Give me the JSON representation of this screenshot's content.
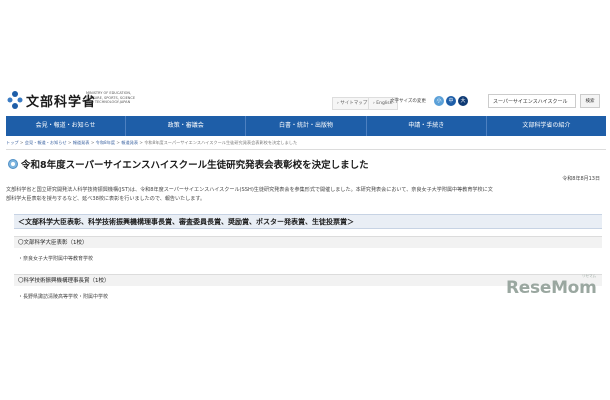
{
  "header": {
    "logo_text": "文部科学省",
    "logo_sub": "MINISTRY OF EDUCATION, CULTURE, SPORTS, SCIENCE AND TECHNOLOGY-JAPAN",
    "sitemap": "サイトマップ",
    "english": "English",
    "font_size_label": "文字サイズの変更",
    "font_small": "小",
    "font_medium": "中",
    "font_large": "大",
    "search_value": "スーパーサイエンスハイスクール",
    "search_button": "検索"
  },
  "nav": [
    "会見・報道・お知らせ",
    "政策・審議会",
    "白書・統計・出版物",
    "申請・手続き",
    "文部科学省の紹介"
  ],
  "breadcrumb": {
    "items": [
      "トップ",
      "会見・報道・お知らせ",
      "報道発表",
      "令和8年度",
      "報道発表"
    ],
    "current": "令和8年度スーパーサイエンスハイスクール生徒研究発表会表彰校を決定しました"
  },
  "article": {
    "title": "令和8年度スーパーサイエンスハイスクール生徒研究発表会表彰校を決定しました",
    "date": "令和8年8月13日",
    "body_line1": "文部科学省と国立研究開発法人科学技術振興機構(JST)は、令和8年度スーパーサイエンスハイスクール(SSH)生徒研究発表会を参集形式で開催しました。本研究発表会において、奈良女子大学附属中等教育学校に文",
    "body_line2": "部科学大臣表彰を授与するなど、延べ38校に表彰を行いましたので、報告いたします。",
    "section_heading": "＜文部科学大臣表彰、科学技術振興機構理事長賞、審査委員長賞、奨励賞、ポスター発表賞、生徒投票賞＞",
    "awards": [
      {
        "name": "〇文部科学大臣表彰（1校）",
        "school": "・奈良女子大学附属中等教育学校"
      },
      {
        "name": "〇科学技術振興機構理事長賞（1校）",
        "school": "・長野県諏訪清陵高等学校・附属中学校"
      }
    ]
  },
  "watermark": {
    "text": "ReseMom",
    "small": "リセマム"
  },
  "colors": {
    "nav_bg": "#1e5ea8",
    "section_bg": "#e9eef5",
    "font_small_color": "#5aa0d8",
    "font_medium_color": "#1e5ea8",
    "font_large_color": "#0e3a74"
  }
}
